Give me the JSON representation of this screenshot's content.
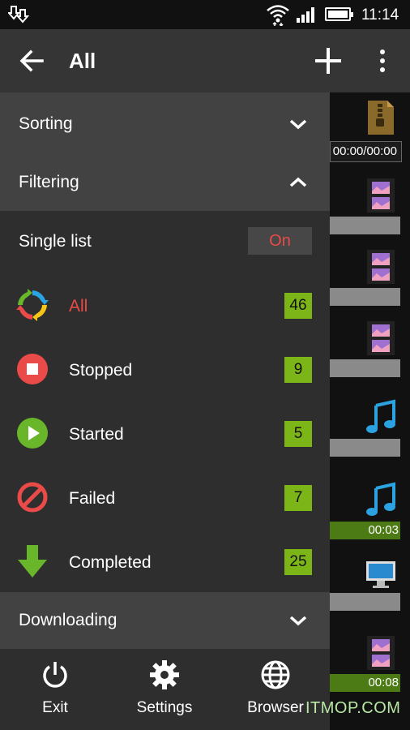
{
  "status": {
    "time": "11:14",
    "icons": [
      "download-status-icon",
      "wifi-icon",
      "signal-icon",
      "battery-icon"
    ]
  },
  "appbar": {
    "title": "All",
    "icons": [
      "back-arrow-icon",
      "add-icon",
      "more-vert-icon"
    ]
  },
  "drawer": {
    "sorting_label": "Sorting",
    "filtering_label": "Filtering",
    "single_list_label": "Single list",
    "single_list_value": "On",
    "filters": [
      {
        "label": "All",
        "count": "46",
        "icon": "all-cycle-icon",
        "color": "#ea4b48"
      },
      {
        "label": "Stopped",
        "count": "9",
        "icon": "stop-icon",
        "color": "#ffffff"
      },
      {
        "label": "Started",
        "count": "5",
        "icon": "play-icon",
        "color": "#ffffff"
      },
      {
        "label": "Failed",
        "count": "7",
        "icon": "blocked-icon",
        "color": "#ffffff"
      },
      {
        "label": "Completed",
        "count": "25",
        "icon": "download-arrow-icon",
        "color": "#ffffff"
      }
    ],
    "downloading_label": "Downloading",
    "bottom": {
      "exit_label": "Exit",
      "settings_label": "Settings",
      "browser_label": "Browser"
    }
  },
  "background_list": {
    "items": [
      {
        "icon": "zip-file-icon",
        "bar_text": "00:00/00:00"
      },
      {
        "icon": "video-file-icon",
        "bar_text": ""
      },
      {
        "icon": "video-file-icon",
        "bar_text": ""
      },
      {
        "icon": "video-file-icon",
        "bar_text": ""
      },
      {
        "icon": "music-note-icon",
        "bar_text": ""
      },
      {
        "icon": "music-note-icon",
        "bar_text": "00:03"
      },
      {
        "icon": "monitor-icon",
        "bar_text": ""
      },
      {
        "icon": "video-file-icon",
        "bar_text": "00:08"
      }
    ]
  },
  "watermark": "ITMOP.COM",
  "colors": {
    "accent_red": "#ea4b48",
    "count_green": "#7cb518",
    "appbar": "#353535",
    "drawer": "#2e2e2e",
    "section_header": "#424242"
  }
}
